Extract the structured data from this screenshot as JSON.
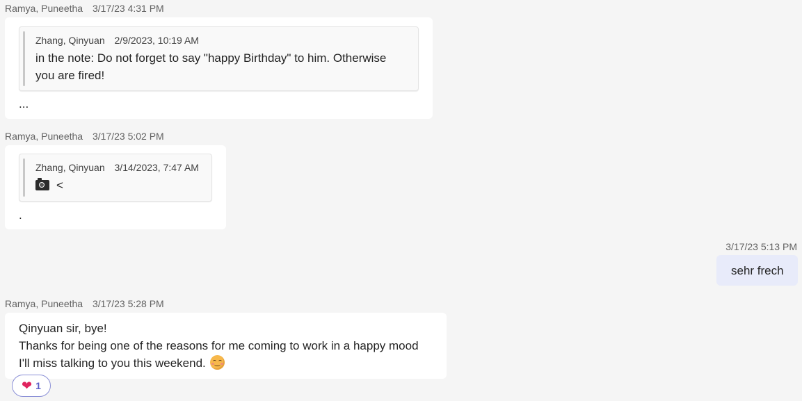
{
  "messages": [
    {
      "author": "Ramya, Puneetha",
      "timestamp": "3/17/23 4:31 PM",
      "quote": {
        "author": "Zhang, Qinyuan",
        "timestamp": "2/9/2023, 10:19 AM",
        "lines": [
          "in the note: Do not forget to say \"happy Birthday\" to him. Otherwise",
          "you are fired!"
        ]
      },
      "text": "..."
    },
    {
      "author": "Ramya, Puneetha",
      "timestamp": "3/17/23 5:02 PM",
      "quote": {
        "author": "Zhang, Qinyuan",
        "timestamp": "3/14/2023, 7:47 AM",
        "icon": "camera-icon",
        "text": "<"
      },
      "text": "."
    },
    {
      "author": "",
      "timestamp": "3/17/23 5:13 PM",
      "text": "sehr frech",
      "mine": true
    },
    {
      "author": "Ramya, Puneetha",
      "timestamp": "3/17/23 5:28 PM",
      "lines": [
        "Qinyuan sir, bye!",
        "Thanks for being one of the reasons for me coming to work in a happy mood",
        "I'll miss talking to you this weekend."
      ],
      "emoji": "smiling-face-icon",
      "reaction": {
        "icon": "heart-icon",
        "count": "1"
      }
    }
  ],
  "colors": {
    "background": "#f5f5f5",
    "bubble": "#ffffff",
    "my_bubble": "#e8ebfa",
    "reaction_border": "#8a8fd6",
    "reaction_count": "#5b5fc7"
  }
}
